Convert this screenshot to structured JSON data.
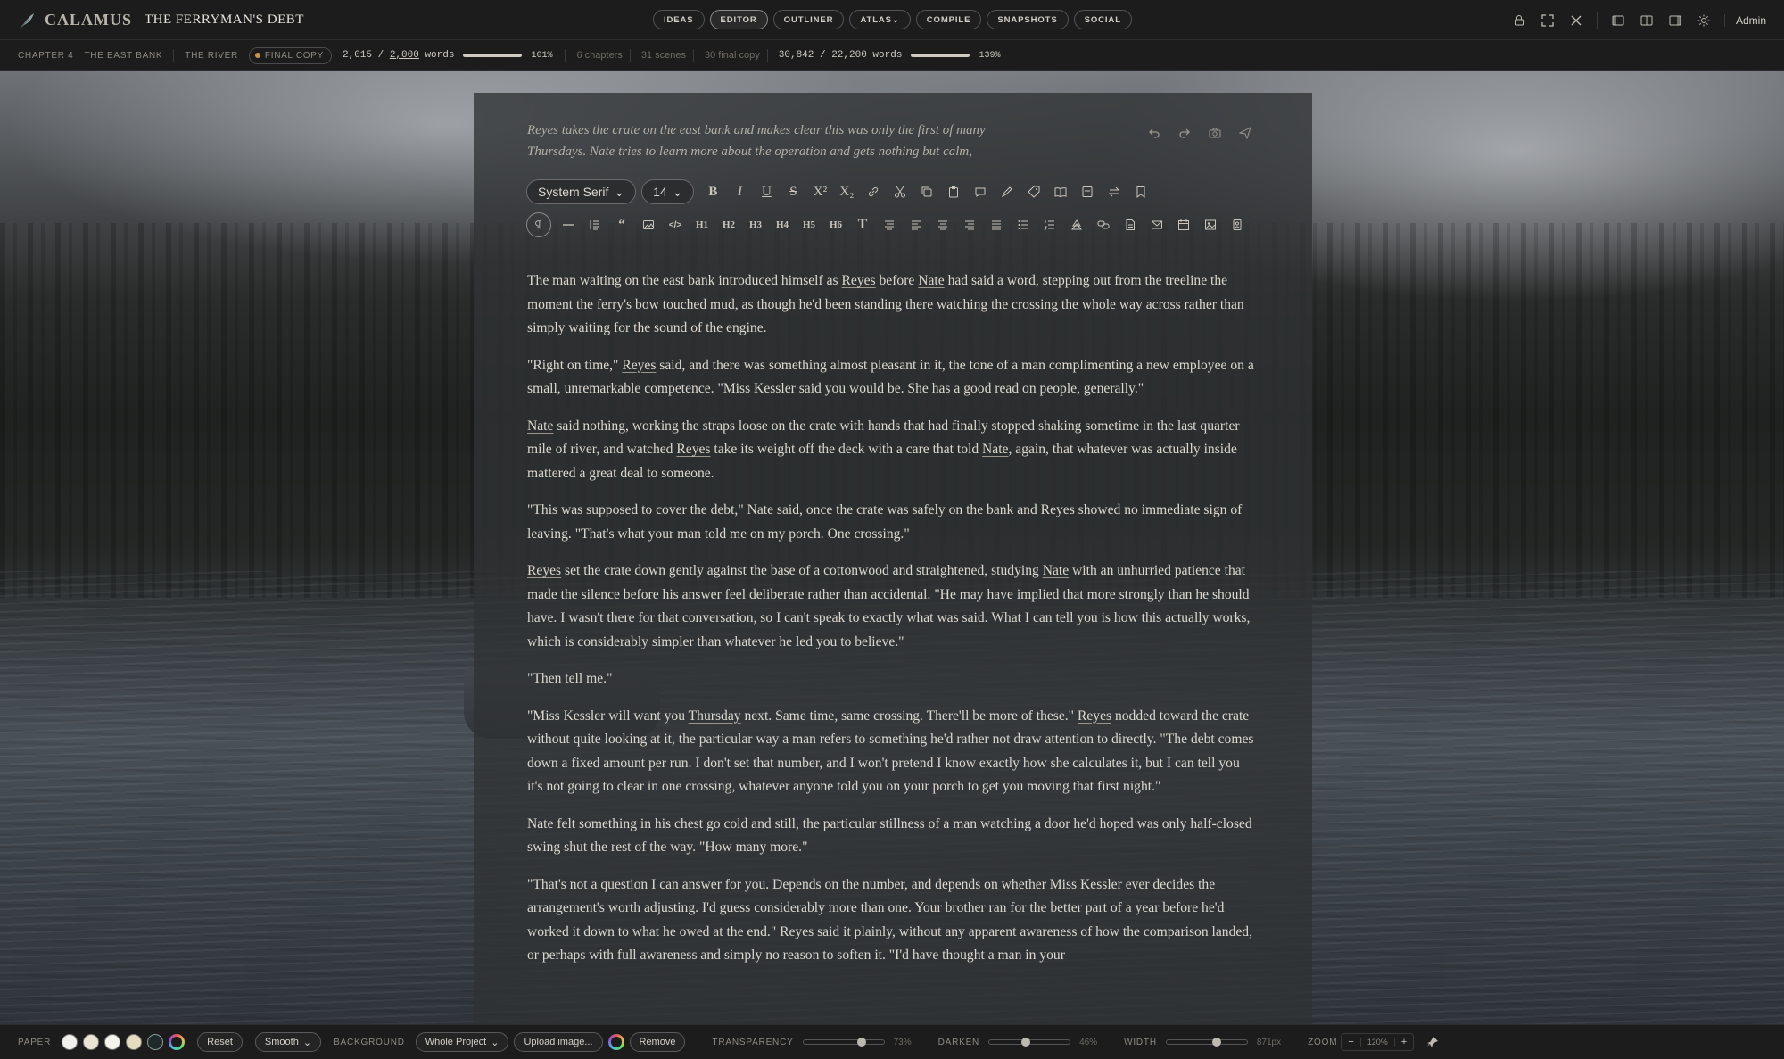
{
  "app": {
    "name": "CALAMUS",
    "book_title": "THE FERRYMAN'S DEBT"
  },
  "nav": {
    "tabs": [
      {
        "label": "IDEAS"
      },
      {
        "label": "EDITOR",
        "active": true
      },
      {
        "label": "OUTLINER"
      },
      {
        "label": "ATLAS",
        "dropdown": true
      },
      {
        "label": "COMPILE"
      },
      {
        "label": "SNAPSHOTS"
      },
      {
        "label": "SOCIAL"
      }
    ]
  },
  "topright": {
    "icons": [
      "lock-icon",
      "fullscreen-icon",
      "tools-icon",
      "panel-left-icon",
      "panel-center-icon",
      "panel-right-icon",
      "theme-sun-icon"
    ],
    "user": "Admin"
  },
  "status": {
    "chapter": "CHAPTER 4",
    "scene": "THE EAST BANK",
    "location": "THE RIVER",
    "badge": "FINAL COPY",
    "badge_color": "#c9963e",
    "scene_words": "2,015",
    "scene_target": "2,000",
    "words_unit": "words",
    "scene_progress": 1.0,
    "scene_pct": "101%",
    "chapters": "6 chapters",
    "scenes": "31 scenes",
    "final_copy": "30 final copy",
    "total_words": "30,842",
    "total_target": "22,200",
    "total_progress": 1.0,
    "total_pct": "139%"
  },
  "editor": {
    "summary": "Reyes takes the crate on the east bank and makes clear this was only the first of many Thursdays. Nate tries to learn more about the operation and gets nothing but calm,",
    "summary_icons": [
      "undo-icon",
      "redo-icon",
      "camera-icon",
      "send-icon"
    ],
    "font": "System Serif",
    "size": "14",
    "headings": [
      "H1",
      "H2",
      "H3",
      "H4",
      "H5",
      "H6"
    ],
    "paragraphs": [
      [
        "The man waiting on the east bank introduced himself as ",
        {
          "n": "Reyes"
        },
        " before ",
        {
          "n": "Nate"
        },
        " had said a word, stepping out from the treeline the moment the ferry's bow touched mud, as though he'd been standing there watching the crossing the whole way across rather than simply waiting for the sound of the engine."
      ],
      [
        "\"Right on time,\" ",
        {
          "n": "Reyes"
        },
        " said, and there was something almost pleasant in it, the tone of a man complimenting a new employee on a small, unremarkable competence. \"Miss Kessler said you would be. She has a good read on people, generally.\""
      ],
      [
        {
          "n": "Nate"
        },
        " said nothing, working the straps loose on the crate with hands that had finally stopped shaking sometime in the last quarter mile of river, and watched ",
        {
          "n": "Reyes"
        },
        " take its weight off the deck with a care that told ",
        {
          "n": "Nate"
        },
        ", again, that whatever was actually inside mattered a great deal to someone."
      ],
      [
        "\"This was supposed to cover the debt,\" ",
        {
          "n": "Nate"
        },
        " said, once the crate was safely on the bank and ",
        {
          "n": "Reyes"
        },
        " showed no immediate sign of leaving. \"That's what your man told me on my porch. One crossing.\""
      ],
      [
        {
          "n": "Reyes"
        },
        " set the crate down gently against the base of a cottonwood and straightened, studying ",
        {
          "n": "Nate"
        },
        " with an unhurried patience that made the silence before his answer feel deliberate rather than accidental. \"He may have implied that more strongly than he should have. I wasn't there for that conversation, so I can't speak to exactly what was said. What I can tell you is how this actually works, which is considerably simpler than whatever he led you to believe.\""
      ],
      [
        "\"Then tell me.\""
      ],
      [
        "\"Miss Kessler will want you ",
        {
          "n": "Thursday"
        },
        " next. Same time, same crossing. There'll be more of these.\" ",
        {
          "n": "Reyes"
        },
        " nodded toward the crate without quite looking at it, the particular way a man refers to something he'd rather not draw attention to directly. \"The debt comes down a fixed amount per run. I don't set that number, and I won't pretend I know exactly how she calculates it, but I can tell you it's not going to clear in one crossing, whatever anyone told you on your porch to get you moving that first night.\""
      ],
      [
        {
          "n": "Nate"
        },
        " felt something in his chest go cold and still, the particular stillness of a man watching a door he'd hoped was only half-closed swing shut the rest of the way. \"How many more.\""
      ],
      [
        "\"That's not a question I can answer for you. Depends on the number, and depends on whether Miss Kessler ever decides the arrangement's worth adjusting. I'd guess considerably more than one. Your brother ran for the better part of a year before he'd worked it down to what he owed at the end.\" ",
        {
          "n": "Reyes"
        },
        " said it plainly, without any apparent awareness of how the comparison landed, or perhaps with full awareness and simply no reason to soften it. \"I'd have thought a man in your"
      ]
    ]
  },
  "bottom": {
    "paper_label": "PAPER",
    "paper_swatches": [
      "#f2f0ec",
      "#ede5d3",
      "#f5f3ee",
      "#e8dcc0",
      "#1e2a2a"
    ],
    "reset": "Reset",
    "smooth": "Smooth",
    "background_label": "BACKGROUND",
    "background_scope": "Whole Project",
    "upload": "Upload image...",
    "remove": "Remove",
    "transparency_label": "TRANSPARENCY",
    "transparency_value": 0.73,
    "transparency_text": "73%",
    "darken_label": "DARKEN",
    "darken_value": 0.46,
    "darken_text": "46%",
    "width_label": "WIDTH",
    "width_value": 0.62,
    "width_text": "871px",
    "zoom_label": "ZOOM",
    "zoom_text": "120%",
    "zoom_minus": "−",
    "zoom_plus": "+"
  }
}
